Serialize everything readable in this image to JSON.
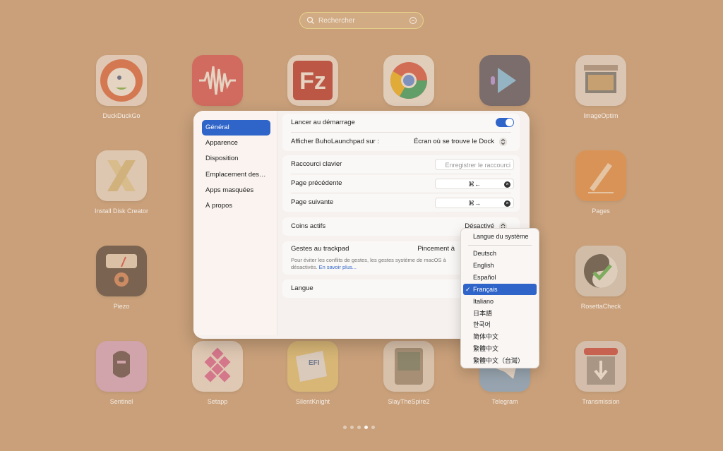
{
  "search": {
    "placeholder": "Rechercher"
  },
  "apps": [
    {
      "label": "DuckDuckGo",
      "icon": "duckduckgo-icon"
    },
    {
      "label": "",
      "icon": "audio-wave-icon"
    },
    {
      "label": "",
      "icon": "filezilla-icon"
    },
    {
      "label": "",
      "icon": "chrome-icon"
    },
    {
      "label": "",
      "icon": "video-player-icon"
    },
    {
      "label": "ImageOptim",
      "icon": "imageoptim-icon"
    },
    {
      "label": "Install Disk Creator",
      "icon": "install-disk-creator-icon"
    },
    {
      "label": "Pages",
      "icon": "pages-icon"
    },
    {
      "label": "Piezo",
      "icon": "piezo-icon"
    },
    {
      "label": "RosettaCheck",
      "icon": "rosettacheck-icon"
    },
    {
      "label": "Sentinel",
      "icon": "sentinel-icon"
    },
    {
      "label": "Setapp",
      "icon": "setapp-icon"
    },
    {
      "label": "SilentKnight",
      "icon": "silentknight-icon"
    },
    {
      "label": "SlayTheSpire2",
      "icon": "slaythespire-icon"
    },
    {
      "label": "Telegram",
      "icon": "telegram-icon"
    },
    {
      "label": "Transmission",
      "icon": "transmission-icon"
    }
  ],
  "sidebar": {
    "items": [
      {
        "label": "Général"
      },
      {
        "label": "Apparence"
      },
      {
        "label": "Disposition"
      },
      {
        "label": "Emplacement des…"
      },
      {
        "label": "Apps masquées"
      },
      {
        "label": "À propos"
      }
    ]
  },
  "settings": {
    "launch_at_login": "Lancer au démarrage",
    "show_on": "Afficher BuhoLaunchpad sur :",
    "show_on_value": "Écran où se trouve le Dock",
    "shortcut": "Raccourci clavier",
    "shortcut_placeholder": "Enregistrer le raccourci",
    "prev_page": "Page précédente",
    "prev_page_keys": "⌘←",
    "next_page": "Page suivante",
    "next_page_keys": "⌘→",
    "hot_corners": "Coins actifs",
    "hot_corners_value": "Désactivé",
    "trackpad": "Gestes au trackpad",
    "trackpad_value": "Pincement à",
    "trackpad_note": "Pour éviter les conflits de gestes, les gestes système de macOS à",
    "trackpad_note2": "désactivés.",
    "learn_more": "En savoir plus...",
    "language": "Langue"
  },
  "language_menu": {
    "system": "Langue du système",
    "options": [
      "Deutsch",
      "English",
      "Español",
      "Français",
      "Italiano",
      "日本語",
      "한국어",
      "简体中文",
      "繁體中文",
      "繁體中文（台灣）"
    ],
    "selected": "Français",
    "check": "✓"
  },
  "colors": {
    "accent": "#2f64c9",
    "background": "#c9a07a"
  }
}
